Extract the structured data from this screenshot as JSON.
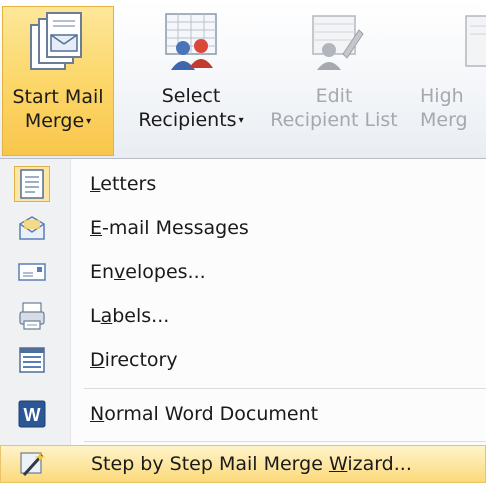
{
  "ribbon": {
    "start_mail_merge": {
      "line1": "Start Mail",
      "line2": "Merge",
      "arrow": "▾"
    },
    "select_recipients": {
      "line1": "Select",
      "line2": "Recipients",
      "arrow": "▾"
    },
    "edit_recipient_list": {
      "line1": "Edit",
      "line2": "Recipient List"
    },
    "highlight_merge_fields": {
      "line1": "High",
      "line2": "Merg"
    }
  },
  "menu": {
    "items": [
      {
        "pre": "",
        "key": "L",
        "post": "etters",
        "icon": "letters-icon",
        "checked": true
      },
      {
        "pre": "",
        "key": "E",
        "post": "-mail Messages",
        "icon": "email-messages-icon"
      },
      {
        "pre": "En",
        "key": "v",
        "post": "elopes...",
        "icon": "envelope-icon"
      },
      {
        "pre": "L",
        "key": "a",
        "post": "bels...",
        "icon": "labels-icon"
      },
      {
        "pre": "",
        "key": "D",
        "post": "irectory",
        "icon": "directory-icon"
      },
      {
        "pre": "",
        "key": "N",
        "post": "ormal Word Document",
        "icon": "word-document-icon"
      },
      {
        "pre": "Step by Step Mail Merge ",
        "key": "W",
        "post": "izard...",
        "icon": "wizard-icon",
        "highlighted": true
      }
    ]
  },
  "colors": {
    "active_button": "#fcd76a",
    "highlight": "#fde7a3",
    "word_blue": "#2b5797"
  }
}
